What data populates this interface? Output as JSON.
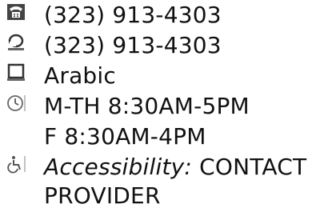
{
  "contact": {
    "phone": "(323) 913-4303",
    "phone_alt": "(323) 913-4303",
    "language": "Arabic",
    "hours_line1": "M-TH 8:30AM-5PM",
    "hours_line2": "F 8:30AM-4PM",
    "accessibility_label": "Accessibility:",
    "accessibility_value_line1": "CONTACT",
    "accessibility_value_line2": "PROVIDER"
  },
  "icons": {
    "phone": "telephone-icon",
    "phone_alt": "alt-phone-icon",
    "language": "language-icon",
    "hours": "clock-icon",
    "accessibility": "wheelchair-icon"
  }
}
